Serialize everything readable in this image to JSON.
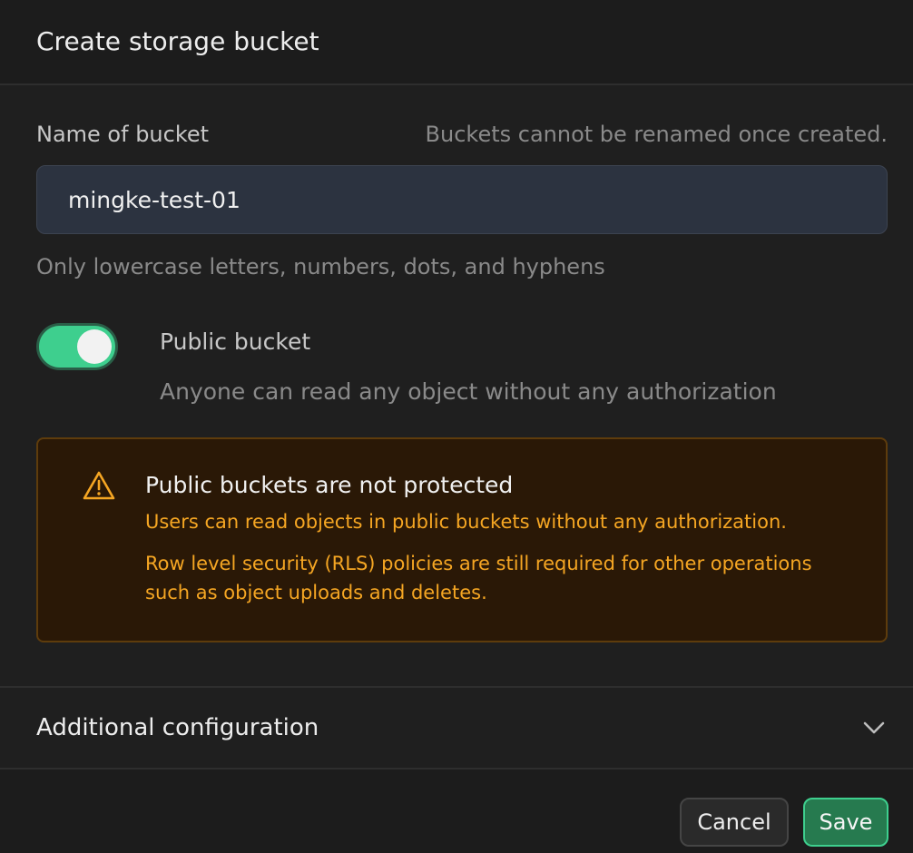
{
  "dialog": {
    "title": "Create storage bucket"
  },
  "bucket_name": {
    "label": "Name of bucket",
    "hint": "Buckets cannot be renamed once created.",
    "value": "mingke-test-01",
    "help": "Only lowercase letters, numbers, dots, and hyphens"
  },
  "public_toggle": {
    "label": "Public bucket",
    "description": "Anyone can read any object without any authorization",
    "checked": true
  },
  "alert": {
    "title": "Public buckets are not protected",
    "line1": "Users can read objects in public buckets without any authorization.",
    "line2a": "Row level security (RLS) policies are still required for other operations",
    "line2b": "such as object uploads and deletes.",
    "icon": "warning-triangle-icon"
  },
  "additional": {
    "label": "Additional configuration",
    "icon": "chevron-down-icon"
  },
  "footer": {
    "cancel_label": "Cancel",
    "save_label": "Save"
  },
  "colors": {
    "accent": "#3ecf8e",
    "warning": "#f5a623"
  }
}
